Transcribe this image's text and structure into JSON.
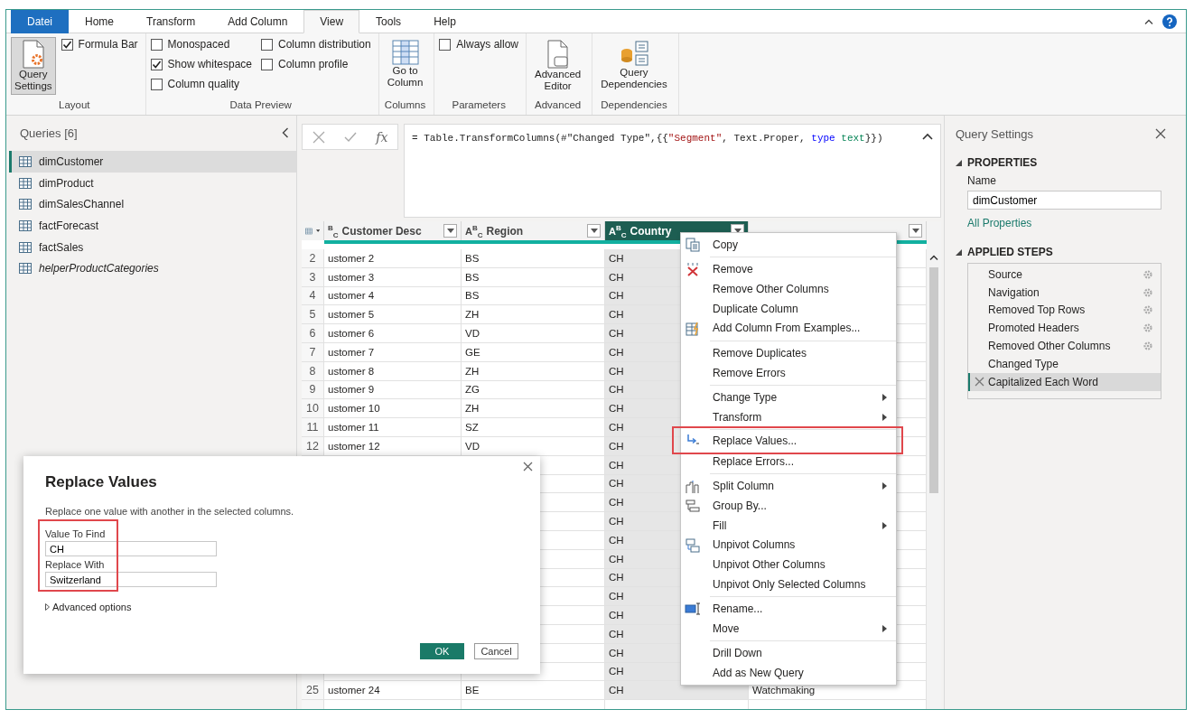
{
  "ribbon": {
    "tabs": [
      {
        "label": "Datei",
        "kind": "file",
        "selected": false
      },
      {
        "label": "Home",
        "kind": "tab",
        "selected": false
      },
      {
        "label": "Transform",
        "kind": "tab",
        "selected": false
      },
      {
        "label": "Add Column",
        "kind": "tab",
        "selected": false
      },
      {
        "label": "View",
        "kind": "tab",
        "selected": true
      },
      {
        "label": "Tools",
        "kind": "tab",
        "selected": false
      },
      {
        "label": "Help",
        "kind": "tab",
        "selected": false
      }
    ],
    "groups": [
      {
        "label": "Layout",
        "items": [
          {
            "kind": "big_button",
            "label": "Query\nSettings",
            "pressed": true
          },
          {
            "kind": "checkbox",
            "label": "Formula Bar",
            "checked": true
          }
        ]
      },
      {
        "label": "Data Preview",
        "items": [
          {
            "kind": "checkbox",
            "label": "Monospaced",
            "checked": false
          },
          {
            "kind": "checkbox",
            "label": "Show whitespace",
            "checked": true
          },
          {
            "kind": "checkbox",
            "label": "Column quality",
            "checked": false
          },
          {
            "kind": "checkbox",
            "label": "Column distribution",
            "checked": false
          },
          {
            "kind": "checkbox",
            "label": "Column profile",
            "checked": false
          }
        ]
      },
      {
        "label": "Columns",
        "items": [
          {
            "kind": "big_button",
            "label": "Go to\nColumn",
            "pressed": false
          }
        ]
      },
      {
        "label": "Parameters",
        "items": [
          {
            "kind": "checkbox",
            "label": "Always allow",
            "checked": false
          }
        ]
      },
      {
        "label": "Advanced",
        "items": [
          {
            "kind": "big_button",
            "label": "Advanced\nEditor",
            "pressed": false
          }
        ]
      },
      {
        "label": "Dependencies",
        "items": [
          {
            "kind": "big_button",
            "label": "Query\nDependencies",
            "pressed": false
          }
        ]
      }
    ]
  },
  "queries": {
    "title": "Queries [6]",
    "items": [
      {
        "label": "dimCustomer",
        "selected": true,
        "load_disabled": false
      },
      {
        "label": "dimProduct",
        "selected": false,
        "load_disabled": false
      },
      {
        "label": "dimSalesChannel",
        "selected": false,
        "load_disabled": false
      },
      {
        "label": "factForecast",
        "selected": false,
        "load_disabled": false
      },
      {
        "label": "factSales",
        "selected": false,
        "load_disabled": false
      },
      {
        "label": "helperProductCategories",
        "selected": false,
        "load_disabled": true
      }
    ]
  },
  "formula": {
    "fx": "fx",
    "tokens": [
      {
        "kind": "plain",
        "text": "= Table.TransformColumns(#\"Changed Type\",{{"
      },
      {
        "kind": "string",
        "text": "\"Segment\""
      },
      {
        "kind": "plain",
        "text": ", Text.Proper, "
      },
      {
        "kind": "keyword",
        "text": "type"
      },
      {
        "kind": "type",
        "text": " text"
      },
      {
        "kind": "plain",
        "text": "}})"
      }
    ]
  },
  "table": {
    "columns": [
      {
        "type": "$^{B}$$_{C}$",
        "label": "Customer Desc",
        "selected": false
      },
      {
        "type": "A$^{B}$$_{C}$",
        "label": "Region",
        "selected": false
      },
      {
        "type": "A$^{B}$$_{C}$",
        "label": "Country",
        "selected": true
      },
      {
        "selected": false
      }
    ],
    "rows": [
      {
        "number": "2",
        "cells": [
          "ustomer 2",
          "BS",
          "CH",
          null
        ]
      },
      {
        "number": "3",
        "cells": [
          "ustomer 3",
          "BS",
          "CH",
          null
        ]
      },
      {
        "number": "4",
        "cells": [
          "ustomer 4",
          "BS",
          "CH",
          null
        ]
      },
      {
        "number": "5",
        "cells": [
          "ustomer 5",
          "ZH",
          "CH",
          null
        ]
      },
      {
        "number": "6",
        "cells": [
          "ustomer 6",
          "VD",
          "CH",
          null
        ]
      },
      {
        "number": "7",
        "cells": [
          "ustomer 7",
          "GE",
          "CH",
          null
        ]
      },
      {
        "number": "8",
        "cells": [
          "ustomer 8",
          "ZH",
          "CH",
          null
        ]
      },
      {
        "number": "9",
        "cells": [
          "ustomer 9",
          "ZG",
          "CH",
          null
        ]
      },
      {
        "number": "10",
        "cells": [
          "ustomer 10",
          "ZH",
          "CH",
          null
        ]
      },
      {
        "number": "11",
        "cells": [
          "ustomer 11",
          "SZ",
          "CH",
          null
        ]
      },
      {
        "number": "12",
        "cells": [
          "ustomer 12",
          "VD",
          "CH",
          null
        ]
      },
      {
        "cells": [
          null,
          null,
          "CH",
          null
        ]
      },
      {
        "cells": [
          null,
          null,
          "CH",
          null
        ]
      },
      {
        "cells": [
          null,
          null,
          "CH",
          null
        ]
      },
      {
        "cells": [
          null,
          null,
          "CH",
          null
        ]
      },
      {
        "cells": [
          null,
          null,
          "CH",
          null
        ]
      },
      {
        "cells": [
          null,
          null,
          "CH",
          null
        ]
      },
      {
        "cells": [
          null,
          null,
          "CH",
          null
        ]
      },
      {
        "cells": [
          null,
          null,
          "CH",
          null
        ]
      },
      {
        "cells": [
          null,
          null,
          "CH",
          null
        ]
      },
      {
        "cells": [
          null,
          null,
          "CH",
          null
        ]
      },
      {
        "cells": [
          null,
          null,
          "CH",
          null
        ]
      },
      {
        "cells": [
          null,
          null,
          "CH",
          null
        ]
      },
      {
        "number": "25",
        "cells": [
          "ustomer 24",
          "BE",
          "CH",
          "Watchmaking"
        ]
      }
    ]
  },
  "context_menu": {
    "items": [
      {
        "kind": "action",
        "label": "Copy",
        "submenu": false,
        "highlighted": false
      },
      {
        "kind": "separator"
      },
      {
        "kind": "action",
        "label": "Remove",
        "submenu": false,
        "highlighted": false
      },
      {
        "kind": "action",
        "label": "Remove Other Columns",
        "submenu": false,
        "highlighted": false
      },
      {
        "kind": "action",
        "label": "Duplicate Column",
        "submenu": false,
        "highlighted": false
      },
      {
        "kind": "action",
        "label": "Add Column From Examples...",
        "submenu": false,
        "highlighted": false
      },
      {
        "kind": "separator"
      },
      {
        "kind": "action",
        "label": "Remove Duplicates",
        "submenu": false,
        "highlighted": false
      },
      {
        "kind": "action",
        "label": "Remove Errors",
        "submenu": false,
        "highlighted": false
      },
      {
        "kind": "separator"
      },
      {
        "kind": "action",
        "label": "Change Type",
        "submenu": true,
        "highlighted": false
      },
      {
        "kind": "action",
        "label": "Transform",
        "submenu": true,
        "highlighted": false
      },
      {
        "kind": "separator"
      },
      {
        "kind": "action",
        "label": "Replace Values...",
        "submenu": false,
        "highlighted": true
      },
      {
        "kind": "action",
        "label": "Replace Errors...",
        "submenu": false,
        "highlighted": false
      },
      {
        "kind": "separator"
      },
      {
        "kind": "action",
        "label": "Split Column",
        "submenu": true,
        "highlighted": false
      },
      {
        "kind": "action",
        "label": "Group By...",
        "submenu": false,
        "highlighted": false
      },
      {
        "kind": "action",
        "label": "Fill",
        "submenu": true,
        "highlighted": false
      },
      {
        "kind": "action",
        "label": "Unpivot Columns",
        "submenu": false,
        "highlighted": false
      },
      {
        "kind": "action",
        "label": "Unpivot Other Columns",
        "submenu": false,
        "highlighted": false
      },
      {
        "kind": "action",
        "label": "Unpivot Only Selected Columns",
        "submenu": false,
        "highlighted": false
      },
      {
        "kind": "separator"
      },
      {
        "kind": "action",
        "label": "Rename...",
        "submenu": false,
        "highlighted": false
      },
      {
        "kind": "action",
        "label": "Move",
        "submenu": true,
        "highlighted": false
      },
      {
        "kind": "separator"
      },
      {
        "kind": "action",
        "label": "Drill Down",
        "submenu": false,
        "highlighted": false
      },
      {
        "kind": "action",
        "label": "Add as New Query",
        "submenu": false,
        "highlighted": false
      }
    ]
  },
  "dialog": {
    "title": "Replace Values",
    "description": "Replace one value with another in the selected columns.",
    "fields_highlighted": true,
    "fields": [
      {
        "label": "Value To Find",
        "value": "CH"
      },
      {
        "label": "Replace With",
        "value": "Switzerland"
      }
    ],
    "advanced": "Advanced options",
    "buttons": [
      {
        "label": "OK",
        "kind": "primary"
      },
      {
        "label": "Cancel",
        "kind": "secondary"
      }
    ]
  },
  "query_settings": {
    "title": "Query Settings",
    "properties": {
      "heading": "PROPERTIES",
      "name_label": "Name",
      "name_value": "dimCustomer",
      "link": "All Properties"
    },
    "steps_heading": "APPLIED STEPS",
    "steps": [
      {
        "label": "Source",
        "selected": false,
        "has_settings": true
      },
      {
        "label": "Navigation",
        "selected": false,
        "has_settings": true
      },
      {
        "label": "Removed Top Rows",
        "selected": false,
        "has_settings": true
      },
      {
        "label": "Promoted Headers",
        "selected": false,
        "has_settings": true
      },
      {
        "label": "Removed Other Columns",
        "selected": false,
        "has_settings": true
      },
      {
        "label": "Changed Type",
        "selected": false,
        "has_settings": false
      },
      {
        "label": "Capitalized Each Word",
        "selected": true,
        "has_settings": false
      }
    ]
  }
}
